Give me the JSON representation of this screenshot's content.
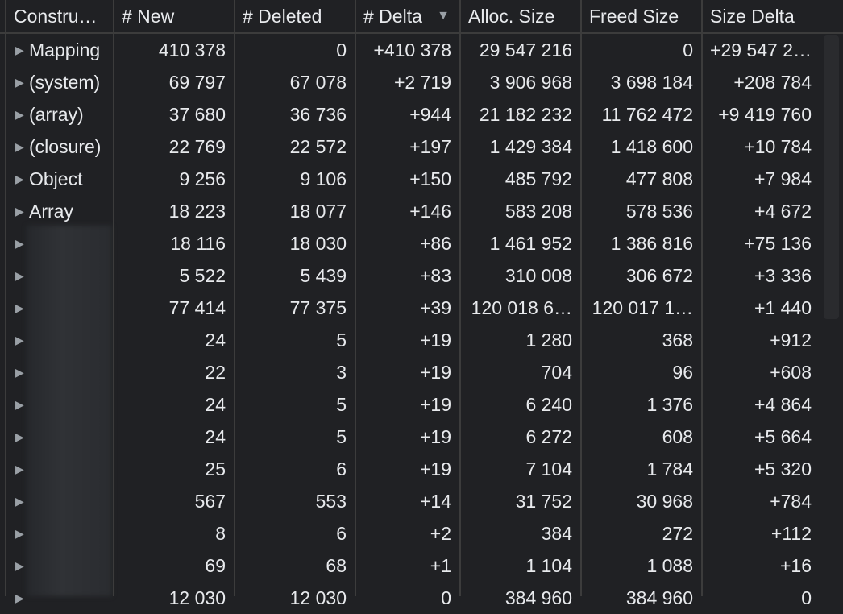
{
  "columns": [
    {
      "label": "Constru…"
    },
    {
      "label": "# New"
    },
    {
      "label": "# Deleted"
    },
    {
      "label": "# Delta"
    },
    {
      "label": "Alloc. Size"
    },
    {
      "label": "Freed Size"
    },
    {
      "label": "Size Delta"
    }
  ],
  "sort_icon": "▼",
  "rows": [
    {
      "name": "Mapping",
      "new": "410 378",
      "deleted": "0",
      "delta": "+410 378",
      "alloc": "29 547 216",
      "freed": "0",
      "size_delta": "+29 547 2…"
    },
    {
      "name": "(system)",
      "new": "69 797",
      "deleted": "67 078",
      "delta": "+2 719",
      "alloc": "3 906 968",
      "freed": "3 698 184",
      "size_delta": "+208 784"
    },
    {
      "name": "(array)",
      "new": "37 680",
      "deleted": "36 736",
      "delta": "+944",
      "alloc": "21 182 232",
      "freed": "11 762 472",
      "size_delta": "+9 419 760"
    },
    {
      "name": "(closure)",
      "new": "22 769",
      "deleted": "22 572",
      "delta": "+197",
      "alloc": "1 429 384",
      "freed": "1 418 600",
      "size_delta": "+10 784"
    },
    {
      "name": "Object",
      "new": "9 256",
      "deleted": "9 106",
      "delta": "+150",
      "alloc": "485 792",
      "freed": "477 808",
      "size_delta": "+7 984"
    },
    {
      "name": "Array",
      "new": "18 223",
      "deleted": "18 077",
      "delta": "+146",
      "alloc": "583 208",
      "freed": "578 536",
      "size_delta": "+4 672"
    },
    {
      "name": "",
      "new": "18 116",
      "deleted": "18 030",
      "delta": "+86",
      "alloc": "1 461 952",
      "freed": "1 386 816",
      "size_delta": "+75 136"
    },
    {
      "name": "",
      "new": "5 522",
      "deleted": "5 439",
      "delta": "+83",
      "alloc": "310 008",
      "freed": "306 672",
      "size_delta": "+3 336"
    },
    {
      "name": "",
      "new": "77 414",
      "deleted": "77 375",
      "delta": "+39",
      "alloc": "120 018 6…",
      "freed": "120 017 1…",
      "size_delta": "+1 440"
    },
    {
      "name": "",
      "new": "24",
      "deleted": "5",
      "delta": "+19",
      "alloc": "1 280",
      "freed": "368",
      "size_delta": "+912"
    },
    {
      "name": "",
      "new": "22",
      "deleted": "3",
      "delta": "+19",
      "alloc": "704",
      "freed": "96",
      "size_delta": "+608"
    },
    {
      "name": "",
      "new": "24",
      "deleted": "5",
      "delta": "+19",
      "alloc": "6 240",
      "freed": "1 376",
      "size_delta": "+4 864"
    },
    {
      "name": "",
      "new": "24",
      "deleted": "5",
      "delta": "+19",
      "alloc": "6 272",
      "freed": "608",
      "size_delta": "+5 664"
    },
    {
      "name": "",
      "new": "25",
      "deleted": "6",
      "delta": "+19",
      "alloc": "7 104",
      "freed": "1 784",
      "size_delta": "+5 320"
    },
    {
      "name": "",
      "new": "567",
      "deleted": "553",
      "delta": "+14",
      "alloc": "31 752",
      "freed": "30 968",
      "size_delta": "+784"
    },
    {
      "name": "",
      "new": "8",
      "deleted": "6",
      "delta": "+2",
      "alloc": "384",
      "freed": "272",
      "size_delta": "+112"
    },
    {
      "name": "",
      "new": "69",
      "deleted": "68",
      "delta": "+1",
      "alloc": "1 104",
      "freed": "1 088",
      "size_delta": "+16"
    },
    {
      "name": "",
      "new": "12 030",
      "deleted": "12 030",
      "delta": "0",
      "alloc": "384 960",
      "freed": "384 960",
      "size_delta": "0"
    }
  ],
  "expand_icon": "▶"
}
